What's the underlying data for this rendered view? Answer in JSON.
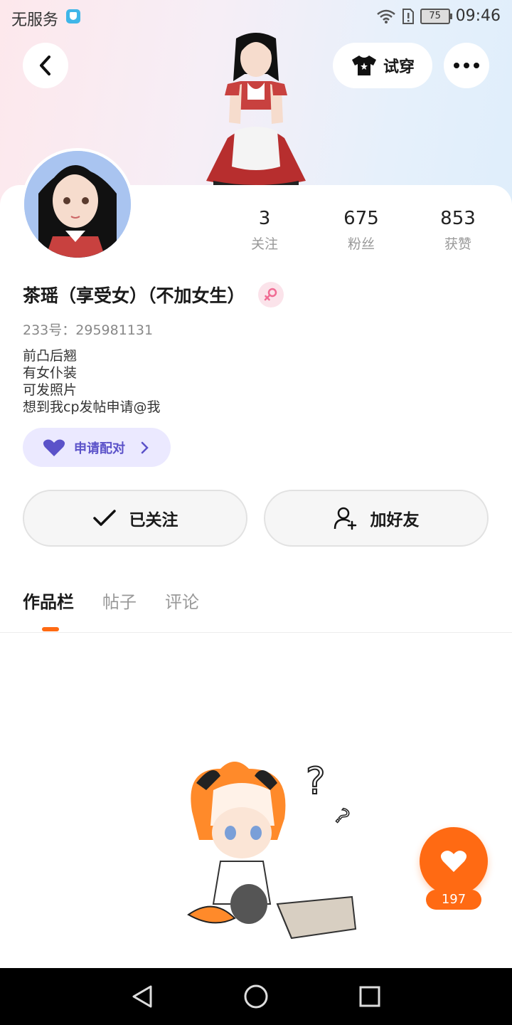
{
  "status_bar": {
    "carrier": "无服务",
    "battery": "75",
    "time": "09:46"
  },
  "header": {
    "tryon_label": "试穿"
  },
  "profile": {
    "stats": [
      {
        "value": "3",
        "label": "关注"
      },
      {
        "value": "675",
        "label": "粉丝"
      },
      {
        "value": "853",
        "label": "获赞"
      }
    ],
    "name": "茶瑶（享受女）（不加女生）",
    "uid": "233号：295981131",
    "bio": [
      "前凸后翘",
      "有女仆装",
      "可发照片",
      "想到我cp发帖申请@我"
    ],
    "match_label": "申请配对",
    "follow_label": "已关注",
    "add_friend_label": "加好友"
  },
  "tabs": [
    {
      "label": "作品栏",
      "active": true
    },
    {
      "label": "帖子",
      "active": false
    },
    {
      "label": "评论",
      "active": false
    }
  ],
  "like_count": "197",
  "colors": {
    "accent": "#ff6a13",
    "match_bg": "#ebe9ff",
    "match_text": "#5b52c9"
  },
  "icons": [
    "back-icon",
    "shirt-icon",
    "more-icon",
    "female-gender-icon",
    "heart-icon",
    "chevron-right-icon",
    "check-icon",
    "add-user-icon",
    "nav-back-icon",
    "nav-home-icon",
    "nav-recents-icon"
  ]
}
